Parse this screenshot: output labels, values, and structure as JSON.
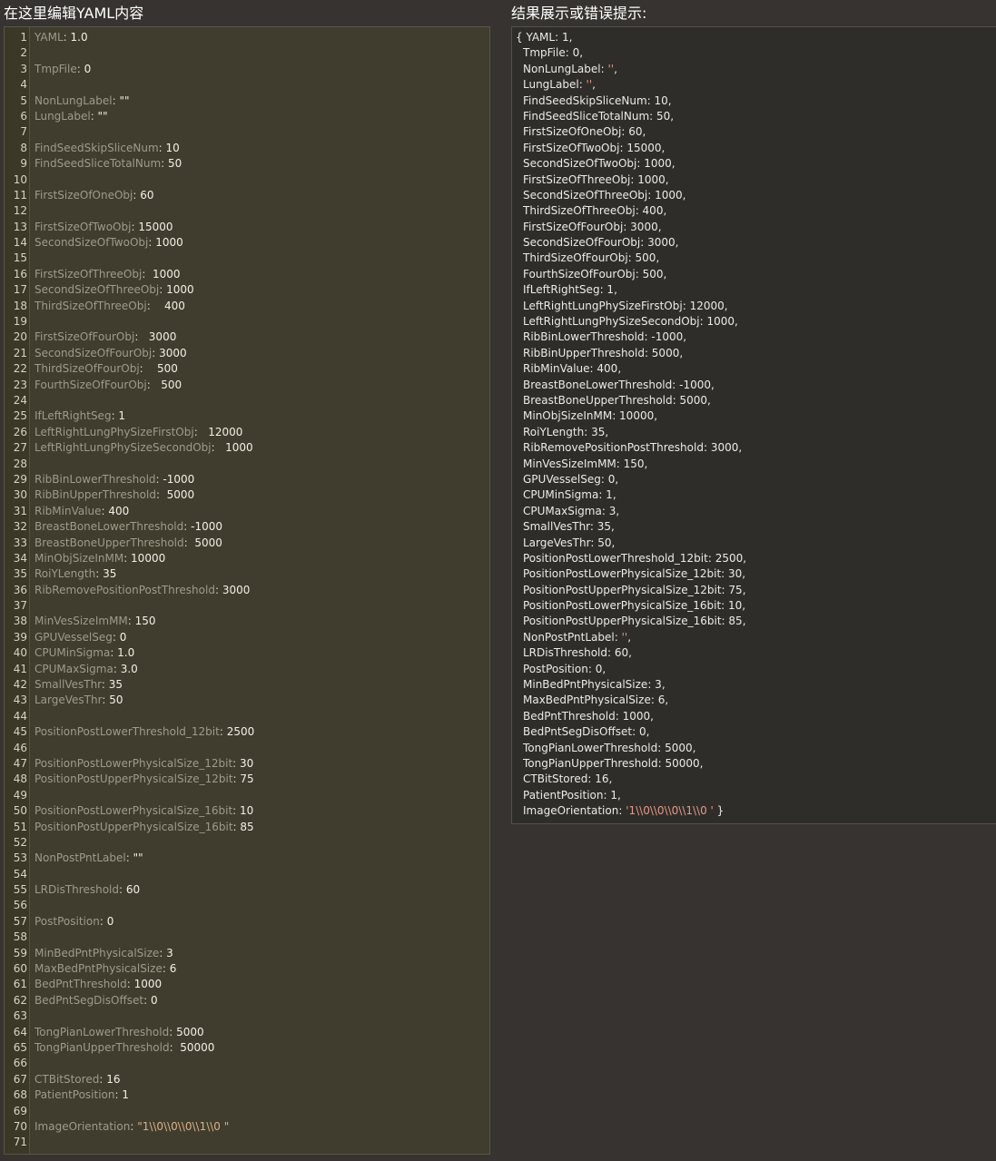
{
  "left_heading": "在这里编辑YAML内容",
  "right_heading": "结果展示或错误提示:",
  "editor_lines": [
    {
      "n": "1",
      "k": "YAML",
      "v": "1.0"
    },
    {
      "n": "2"
    },
    {
      "n": "3",
      "k": "TmpFile",
      "v": "0"
    },
    {
      "n": "4"
    },
    {
      "n": "5",
      "k": "NonLungLabel",
      "v": "\"\""
    },
    {
      "n": "6",
      "k": "LungLabel",
      "v": "\"\""
    },
    {
      "n": "7"
    },
    {
      "n": "8",
      "k": "FindSeedSkipSliceNum",
      "v": "10"
    },
    {
      "n": "9",
      "k": "FindSeedSliceTotalNum",
      "v": "50"
    },
    {
      "n": "10"
    },
    {
      "n": "11",
      "k": "FirstSizeOfOneObj",
      "v": "60"
    },
    {
      "n": "12"
    },
    {
      "n": "13",
      "k": "FirstSizeOfTwoObj",
      "v": "15000"
    },
    {
      "n": "14",
      "k": "SecondSizeOfTwoObj",
      "v": "1000"
    },
    {
      "n": "15"
    },
    {
      "n": "16",
      "k": "FirstSizeOfThreeObj",
      "v": " 1000"
    },
    {
      "n": "17",
      "k": "SecondSizeOfThreeObj",
      "v": "1000"
    },
    {
      "n": "18",
      "k": "ThirdSizeOfThreeObj",
      "v": "   400"
    },
    {
      "n": "19"
    },
    {
      "n": "20",
      "k": "FirstSizeOfFourObj",
      "v": "  3000"
    },
    {
      "n": "21",
      "k": "SecondSizeOfFourObj",
      "v": "3000"
    },
    {
      "n": "22",
      "k": "ThirdSizeOfFourObj",
      "v": "   500"
    },
    {
      "n": "23",
      "k": "FourthSizeOfFourObj",
      "v": "  500"
    },
    {
      "n": "24"
    },
    {
      "n": "25",
      "k": "IfLeftRightSeg",
      "v": "1"
    },
    {
      "n": "26",
      "k": "LeftRightLungPhySizeFirstObj",
      "v": "  12000"
    },
    {
      "n": "27",
      "k": "LeftRightLungPhySizeSecondObj",
      "v": "  1000"
    },
    {
      "n": "28"
    },
    {
      "n": "29",
      "k": "RibBinLowerThreshold",
      "v": "-1000"
    },
    {
      "n": "30",
      "k": "RibBinUpperThreshold",
      "v": " 5000"
    },
    {
      "n": "31",
      "k": "RibMinValue",
      "v": "400"
    },
    {
      "n": "32",
      "k": "BreastBoneLowerThreshold",
      "v": "-1000"
    },
    {
      "n": "33",
      "k": "BreastBoneUpperThreshold",
      "v": " 5000"
    },
    {
      "n": "34",
      "k": "MinObjSizeInMM",
      "v": "10000"
    },
    {
      "n": "35",
      "k": "RoiYLength",
      "v": "35"
    },
    {
      "n": "36",
      "k": "RibRemovePositionPostThreshold",
      "v": "3000"
    },
    {
      "n": "37"
    },
    {
      "n": "38",
      "k": "MinVesSizeImMM",
      "v": "150"
    },
    {
      "n": "39",
      "k": "GPUVesselSeg",
      "v": "0"
    },
    {
      "n": "40",
      "k": "CPUMinSigma",
      "v": "1.0"
    },
    {
      "n": "41",
      "k": "CPUMaxSigma",
      "v": "3.0"
    },
    {
      "n": "42",
      "k": "SmallVesThr",
      "v": "35"
    },
    {
      "n": "43",
      "k": "LargeVesThr",
      "v": "50"
    },
    {
      "n": "44"
    },
    {
      "n": "45",
      "k": "PositionPostLowerThreshold_12bit",
      "v": "2500"
    },
    {
      "n": "46"
    },
    {
      "n": "47",
      "k": "PositionPostLowerPhysicalSize_12bit",
      "v": "30"
    },
    {
      "n": "48",
      "k": "PositionPostUpperPhysicalSize_12bit",
      "v": "75"
    },
    {
      "n": "49"
    },
    {
      "n": "50",
      "k": "PositionPostLowerPhysicalSize_16bit",
      "v": "10"
    },
    {
      "n": "51",
      "k": "PositionPostUpperPhysicalSize_16bit",
      "v": "85"
    },
    {
      "n": "52"
    },
    {
      "n": "53",
      "k": "NonPostPntLabel",
      "v": "\"\""
    },
    {
      "n": "54"
    },
    {
      "n": "55",
      "k": "LRDisThreshold",
      "v": "60"
    },
    {
      "n": "56"
    },
    {
      "n": "57",
      "k": "PostPosition",
      "v": "0"
    },
    {
      "n": "58"
    },
    {
      "n": "59",
      "k": "MinBedPntPhysicalSize",
      "v": "3"
    },
    {
      "n": "60",
      "k": "MaxBedPntPhysicalSize",
      "v": "6"
    },
    {
      "n": "61",
      "k": "BedPntThreshold",
      "v": "1000"
    },
    {
      "n": "62",
      "k": "BedPntSegDisOffset",
      "v": "0"
    },
    {
      "n": "63"
    },
    {
      "n": "64",
      "k": "TongPianLowerThreshold",
      "v": "5000"
    },
    {
      "n": "65",
      "k": "TongPianUpperThreshold",
      "v": " 50000"
    },
    {
      "n": "66"
    },
    {
      "n": "67",
      "k": "CTBitStored",
      "v": "16"
    },
    {
      "n": "68",
      "k": "PatientPosition",
      "v": "1"
    },
    {
      "n": "69"
    },
    {
      "n": "70",
      "k": "ImageOrientation",
      "v": "\"1\\\\0\\\\0\\\\0\\\\1\\\\0 \"",
      "str": true
    },
    {
      "n": "71"
    }
  ],
  "result_lines": [
    {
      "pre": "{ ",
      "k": "YAML",
      "v": "1",
      "end": ","
    },
    {
      "k": "TmpFile",
      "v": "0",
      "end": ","
    },
    {
      "k": "NonLungLabel",
      "v": "''",
      "str": true,
      "end": ","
    },
    {
      "k": "LungLabel",
      "v": "''",
      "str": true,
      "end": ","
    },
    {
      "k": "FindSeedSkipSliceNum",
      "v": "10",
      "end": ","
    },
    {
      "k": "FindSeedSliceTotalNum",
      "v": "50",
      "end": ","
    },
    {
      "k": "FirstSizeOfOneObj",
      "v": "60",
      "end": ","
    },
    {
      "k": "FirstSizeOfTwoObj",
      "v": "15000",
      "end": ","
    },
    {
      "k": "SecondSizeOfTwoObj",
      "v": "1000",
      "end": ","
    },
    {
      "k": "FirstSizeOfThreeObj",
      "v": "1000",
      "end": ","
    },
    {
      "k": "SecondSizeOfThreeObj",
      "v": "1000",
      "end": ","
    },
    {
      "k": "ThirdSizeOfThreeObj",
      "v": "400",
      "end": ","
    },
    {
      "k": "FirstSizeOfFourObj",
      "v": "3000",
      "end": ","
    },
    {
      "k": "SecondSizeOfFourObj",
      "v": "3000",
      "end": ","
    },
    {
      "k": "ThirdSizeOfFourObj",
      "v": "500",
      "end": ","
    },
    {
      "k": "FourthSizeOfFourObj",
      "v": "500",
      "end": ","
    },
    {
      "k": "IfLeftRightSeg",
      "v": "1",
      "end": ","
    },
    {
      "k": "LeftRightLungPhySizeFirstObj",
      "v": "12000",
      "end": ","
    },
    {
      "k": "LeftRightLungPhySizeSecondObj",
      "v": "1000",
      "end": ","
    },
    {
      "k": "RibBinLowerThreshold",
      "v": "-1000",
      "end": ","
    },
    {
      "k": "RibBinUpperThreshold",
      "v": "5000",
      "end": ","
    },
    {
      "k": "RibMinValue",
      "v": "400",
      "end": ","
    },
    {
      "k": "BreastBoneLowerThreshold",
      "v": "-1000",
      "end": ","
    },
    {
      "k": "BreastBoneUpperThreshold",
      "v": "5000",
      "end": ","
    },
    {
      "k": "MinObjSizeInMM",
      "v": "10000",
      "end": ","
    },
    {
      "k": "RoiYLength",
      "v": "35",
      "end": ","
    },
    {
      "k": "RibRemovePositionPostThreshold",
      "v": "3000",
      "end": ","
    },
    {
      "k": "MinVesSizeImMM",
      "v": "150",
      "end": ","
    },
    {
      "k": "GPUVesselSeg",
      "v": "0",
      "end": ","
    },
    {
      "k": "CPUMinSigma",
      "v": "1",
      "end": ","
    },
    {
      "k": "CPUMaxSigma",
      "v": "3",
      "end": ","
    },
    {
      "k": "SmallVesThr",
      "v": "35",
      "end": ","
    },
    {
      "k": "LargeVesThr",
      "v": "50",
      "end": ","
    },
    {
      "k": "PositionPostLowerThreshold_12bit",
      "v": "2500",
      "end": ","
    },
    {
      "k": "PositionPostLowerPhysicalSize_12bit",
      "v": "30",
      "end": ","
    },
    {
      "k": "PositionPostUpperPhysicalSize_12bit",
      "v": "75",
      "end": ","
    },
    {
      "k": "PositionPostLowerPhysicalSize_16bit",
      "v": "10",
      "end": ","
    },
    {
      "k": "PositionPostUpperPhysicalSize_16bit",
      "v": "85",
      "end": ","
    },
    {
      "k": "NonPostPntLabel",
      "v": "''",
      "str": true,
      "end": ","
    },
    {
      "k": "LRDisThreshold",
      "v": "60",
      "end": ","
    },
    {
      "k": "PostPosition",
      "v": "0",
      "end": ","
    },
    {
      "k": "MinBedPntPhysicalSize",
      "v": "3",
      "end": ","
    },
    {
      "k": "MaxBedPntPhysicalSize",
      "v": "6",
      "end": ","
    },
    {
      "k": "BedPntThreshold",
      "v": "1000",
      "end": ","
    },
    {
      "k": "BedPntSegDisOffset",
      "v": "0",
      "end": ","
    },
    {
      "k": "TongPianLowerThreshold",
      "v": "5000",
      "end": ","
    },
    {
      "k": "TongPianUpperThreshold",
      "v": "50000",
      "end": ","
    },
    {
      "k": "CTBitStored",
      "v": "16",
      "end": ","
    },
    {
      "k": "PatientPosition",
      "v": "1",
      "end": ","
    },
    {
      "k": "ImageOrientation",
      "v": "'1\\\\0\\\\0\\\\0\\\\1\\\\0 '",
      "str": true,
      "end": " }"
    }
  ]
}
